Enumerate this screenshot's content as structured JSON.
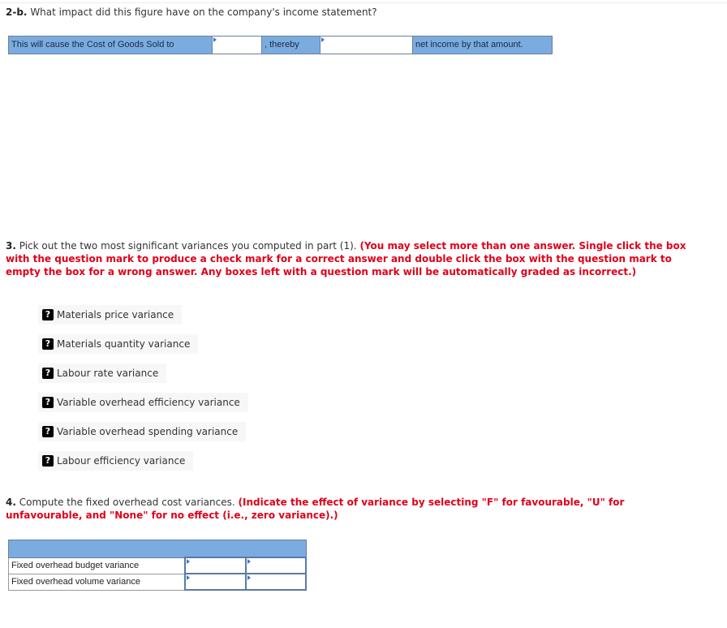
{
  "section_2b": {
    "number": "2-b.",
    "question": "What impact did this figure have on the company's income statement?",
    "sentence": {
      "part1": "This will cause the Cost of Goods Sold to",
      "input1_value": "",
      "part2": ", thereby",
      "input2_value": "",
      "part3": "net income by that amount."
    }
  },
  "section_3": {
    "number": "3.",
    "question": "Pick out the two most significant variances you computed in part (1).",
    "instruction": "(You may select more than one answer. Single click the box with the question mark to produce a check mark for a correct answer and double click the box with the question mark to empty the box for a wrong answer. Any boxes left with a question mark will be automatically graded as incorrect.)",
    "choice_icon": "question-mark-box-icon",
    "choice_icon_glyph": "?",
    "choices": [
      "Materials price variance",
      "Materials quantity variance",
      "Labour rate variance",
      "Variable overhead efficiency variance",
      "Variable overhead spending variance",
      "Labour efficiency variance"
    ]
  },
  "section_4": {
    "number": "4.",
    "question": "Compute the fixed overhead cost variances.",
    "instruction": "(Indicate the effect of variance by selecting \"F\" for favourable, \"U\" for unfavourable, and \"None\" for no effect (i.e., zero variance).)",
    "table": {
      "rows": [
        {
          "label": "Fixed overhead budget variance",
          "amount": "",
          "effect": ""
        },
        {
          "label": "Fixed overhead volume variance",
          "amount": "",
          "effect": ""
        }
      ]
    }
  },
  "colors": {
    "header_blue": "#7aace0",
    "instruction_red": "#e0001a",
    "border_blue": "#5a7aa6"
  }
}
